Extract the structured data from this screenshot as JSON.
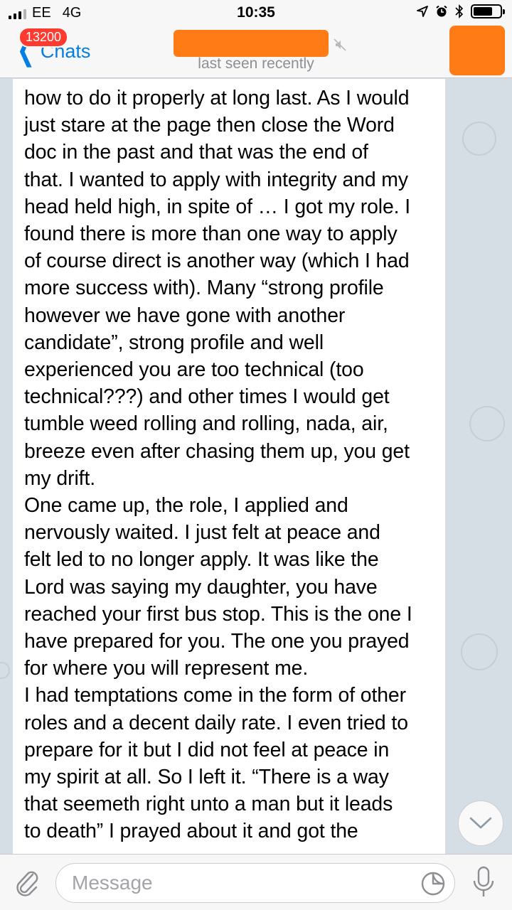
{
  "status_bar": {
    "carrier": "EE",
    "network": "4G",
    "time": "10:35"
  },
  "header": {
    "unread_count": "13200",
    "back_label": "Chats",
    "status": "last seen recently"
  },
  "message": {
    "text": "how to do it properly at long last. As I would\njust stare at the page then close the Word\ndoc in the past and that was the end of\nthat. I wanted to apply with integrity and my\nhead held high, in spite of … I got my role. I\nfound there is more than one way to apply\nof course direct is another way (which I had\nmore success with). Many “strong profile\nhowever we have gone with another\ncandidate”, strong profile and well\nexperienced you are too technical (too\ntechnical???) and other times I would get\ntumble weed rolling and rolling, nada, air,\nbreeze even after chasing them up, you get\nmy drift.\nOne came up, the role, I applied and\nnervously waited. I just felt at peace and\nfelt led to no longer apply. It was like the\nLord was saying my daughter, you have\nreached your first bus stop. This is the one I\nhave prepared for you. The one you prayed\nfor where you will represent me.\nI had temptations come in the form of other\nroles and a decent daily rate. I even tried to\nprepare for it but I did not feel at peace in\nmy spirit at all. So I left it. “There is a way\nthat seemeth right unto a man but it leads\nto death” I prayed about it and got the"
  },
  "input": {
    "placeholder": "Message"
  },
  "icons": {
    "location": "location-arrow-icon",
    "alarm": "alarm-icon",
    "bluetooth": "bluetooth-icon",
    "battery": "battery-icon",
    "mute": "mute-icon",
    "attach": "paperclip-icon",
    "sticker": "sticker-icon",
    "mic": "microphone-icon",
    "scroll": "chevron-down-icon"
  },
  "colors": {
    "accent": "#037ee5",
    "badge": "#ff3b30",
    "redaction": "#ff7b16"
  }
}
